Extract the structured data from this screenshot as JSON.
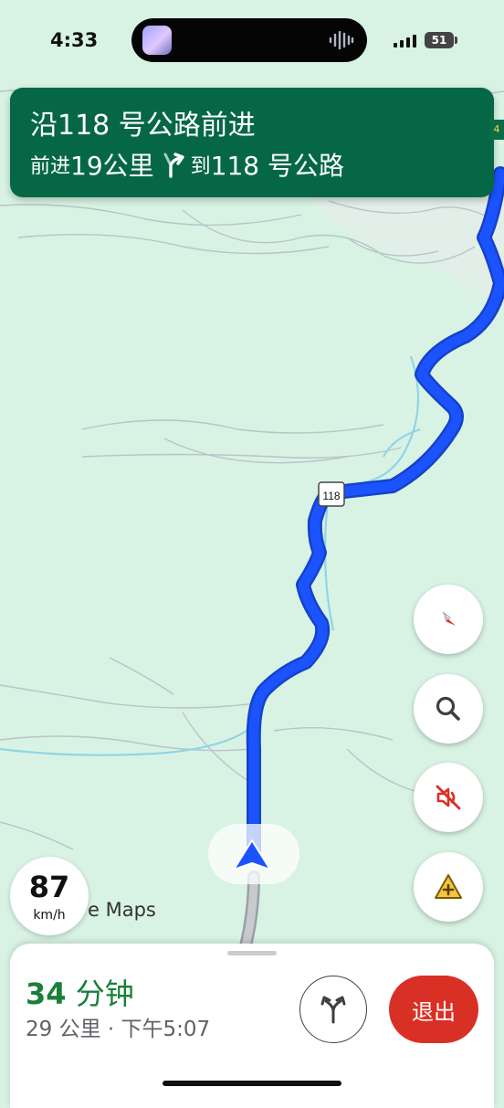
{
  "status_bar": {
    "time": "4:33",
    "battery": "51"
  },
  "navigation": {
    "instruction": "沿118 号公路前进",
    "distance_prefix": "前进",
    "distance": "19公里",
    "then_prefix": "到",
    "then_road": "118 号公路",
    "route_shield": "118",
    "edge_label": "4"
  },
  "speed": {
    "value": "87",
    "unit": "km/h"
  },
  "attribution": "e Maps",
  "bottom_sheet": {
    "eta_number": "34",
    "eta_unit": "分钟",
    "trip_details": "29 公里 · 下午5:07",
    "exit_label": "退出"
  },
  "controls": {
    "compass": "compass-icon",
    "search": "search-icon",
    "mute": "volume-off-icon",
    "report": "report-incident-icon",
    "alternate_routes": "fork-arrows-icon"
  },
  "colors": {
    "banner": "#066747",
    "route": "#1a53ff",
    "eta": "#188038",
    "exit": "#d93025",
    "map_bg": "#d8f3e4",
    "water": "#8fd5e8"
  }
}
